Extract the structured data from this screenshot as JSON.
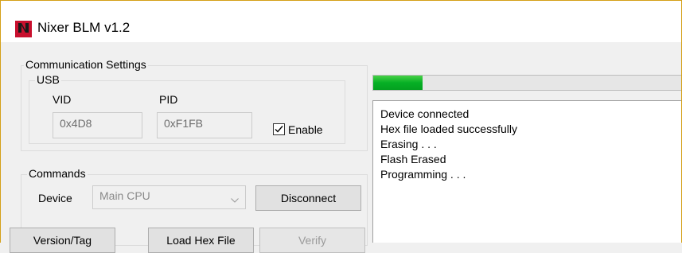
{
  "window": {
    "title": "Nixer BLM v1.2",
    "icon": "nixer-logo-icon",
    "icon_text": "Nixer"
  },
  "communication": {
    "group_label": "Communication Settings",
    "usb": {
      "group_label": "USB",
      "vid_label": "VID",
      "pid_label": "PID",
      "vid_value": "0x4D8",
      "pid_value": "0xF1FB",
      "enable_label": "Enable",
      "enable_checked": true
    }
  },
  "commands": {
    "group_label": "Commands",
    "device_label": "Device",
    "device_selected": "Main CPU",
    "disconnect_label": "Disconnect",
    "version_tag_label": "Version/Tag",
    "load_hex_label": "Load Hex File",
    "verify_label": "Verify"
  },
  "progress": {
    "fraction": 0.16
  },
  "log": {
    "lines": [
      "Device connected",
      "Hex file loaded successfully",
      "Erasing . . .",
      "Flash Erased",
      "Programming . . ."
    ]
  },
  "colors": {
    "progress_green": "#06b025",
    "brand_red": "#c8102e",
    "window_border": "#d4a017"
  }
}
